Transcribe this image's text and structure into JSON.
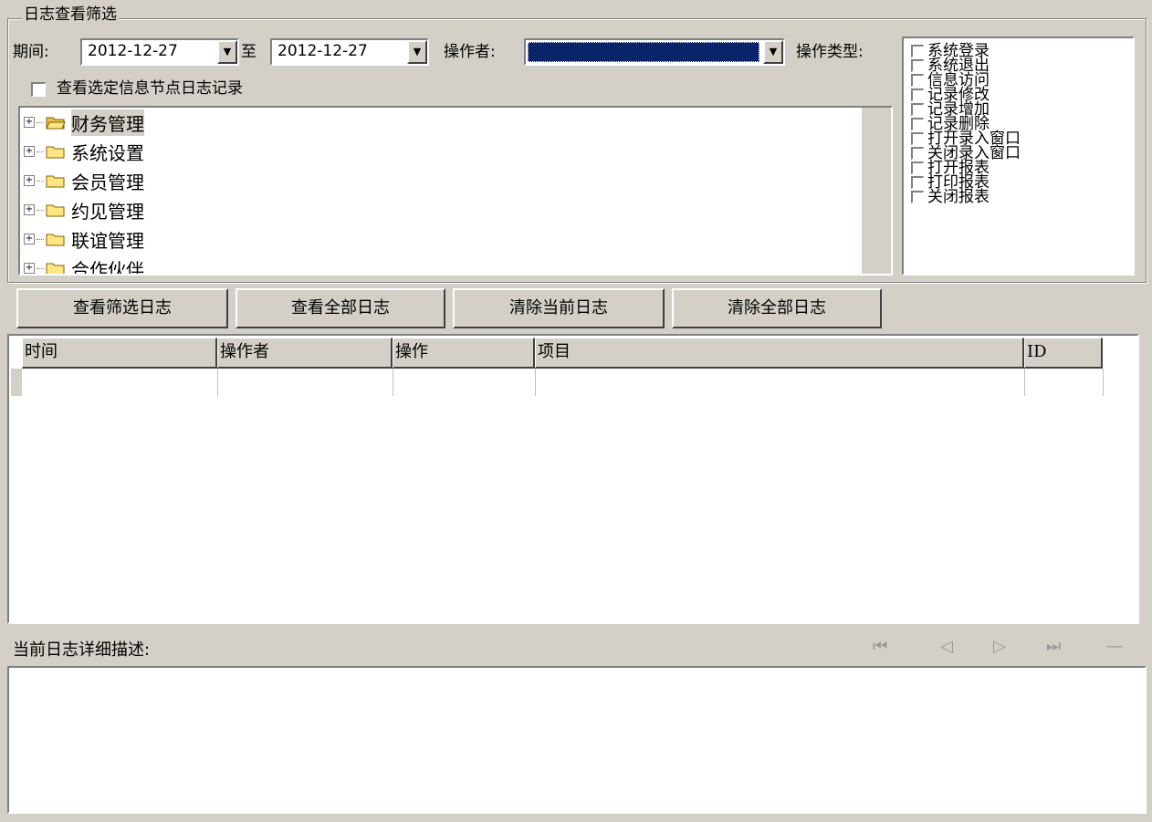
{
  "filter": {
    "group_title": "日志查看筛选",
    "period_label": "期间:",
    "date_from": "2012-12-27",
    "to_label": "至",
    "date_to": "2012-12-27",
    "operator_label": "操作者:",
    "operator_value": "",
    "op_type_label": "操作类型:",
    "view_selected_label": "查看选定信息节点日志记录"
  },
  "tree": {
    "items": [
      {
        "label": "财务管理",
        "selected": true
      },
      {
        "label": "系统设置",
        "selected": false
      },
      {
        "label": "会员管理",
        "selected": false
      },
      {
        "label": "约见管理",
        "selected": false
      },
      {
        "label": "联谊管理",
        "selected": false
      },
      {
        "label": "合作伙伴",
        "selected": false
      }
    ]
  },
  "op_types": [
    "系统登录",
    "系统退出",
    "信息访问",
    "记录修改",
    "记录增加",
    "记录删除",
    "打开录入窗口",
    "关闭录入窗口",
    "打开报表",
    "打印报表",
    "关闭报表"
  ],
  "buttons": {
    "view_filtered": "查看筛选日志",
    "view_all": "查看全部日志",
    "clear_current": "清除当前日志",
    "clear_all": "清除全部日志"
  },
  "grid": {
    "columns": [
      "时间",
      "操作者",
      "操作",
      "项目",
      "ID"
    ]
  },
  "detail": {
    "label": "当前日志详细描述:"
  },
  "nav": {
    "first": "⏮",
    "prev": "◁",
    "next": "▷",
    "last": "⏭",
    "minus": "—"
  },
  "colors": {
    "face": "#d4d0c8",
    "selection": "#0a246a"
  }
}
